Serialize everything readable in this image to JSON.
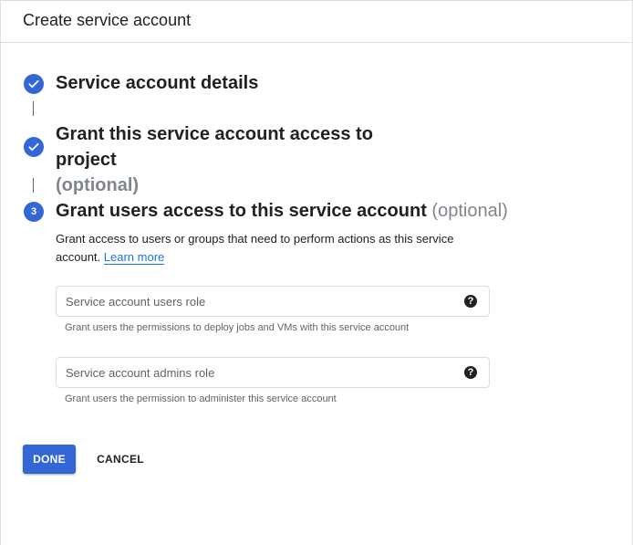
{
  "header": {
    "title": "Create service account"
  },
  "steps": [
    {
      "status": "complete",
      "title": "Service account details",
      "optional": ""
    },
    {
      "status": "complete",
      "title": "Grant this service account access to project",
      "optional": "(optional)"
    },
    {
      "status": "active",
      "number": "3",
      "title": "Grant users access to this service account",
      "optional": "(optional)"
    }
  ],
  "step3": {
    "description": "Grant access to users or groups that need to perform actions as this service account.",
    "learn_more": "Learn more",
    "fields": [
      {
        "placeholder": "Service account users role",
        "value": "",
        "hint": "Grant users the permissions to deploy jobs and VMs with this service account"
      },
      {
        "placeholder": "Service account admins role",
        "value": "",
        "hint": "Grant users the permission to administer this service account"
      }
    ]
  },
  "actions": {
    "done_label": "DONE",
    "cancel_label": "CANCEL"
  },
  "colors": {
    "accent": "#3367d6",
    "link": "#1a73e8",
    "optional_text": "#80868b"
  },
  "icons": {
    "complete": "check-icon",
    "help": "help-icon"
  }
}
